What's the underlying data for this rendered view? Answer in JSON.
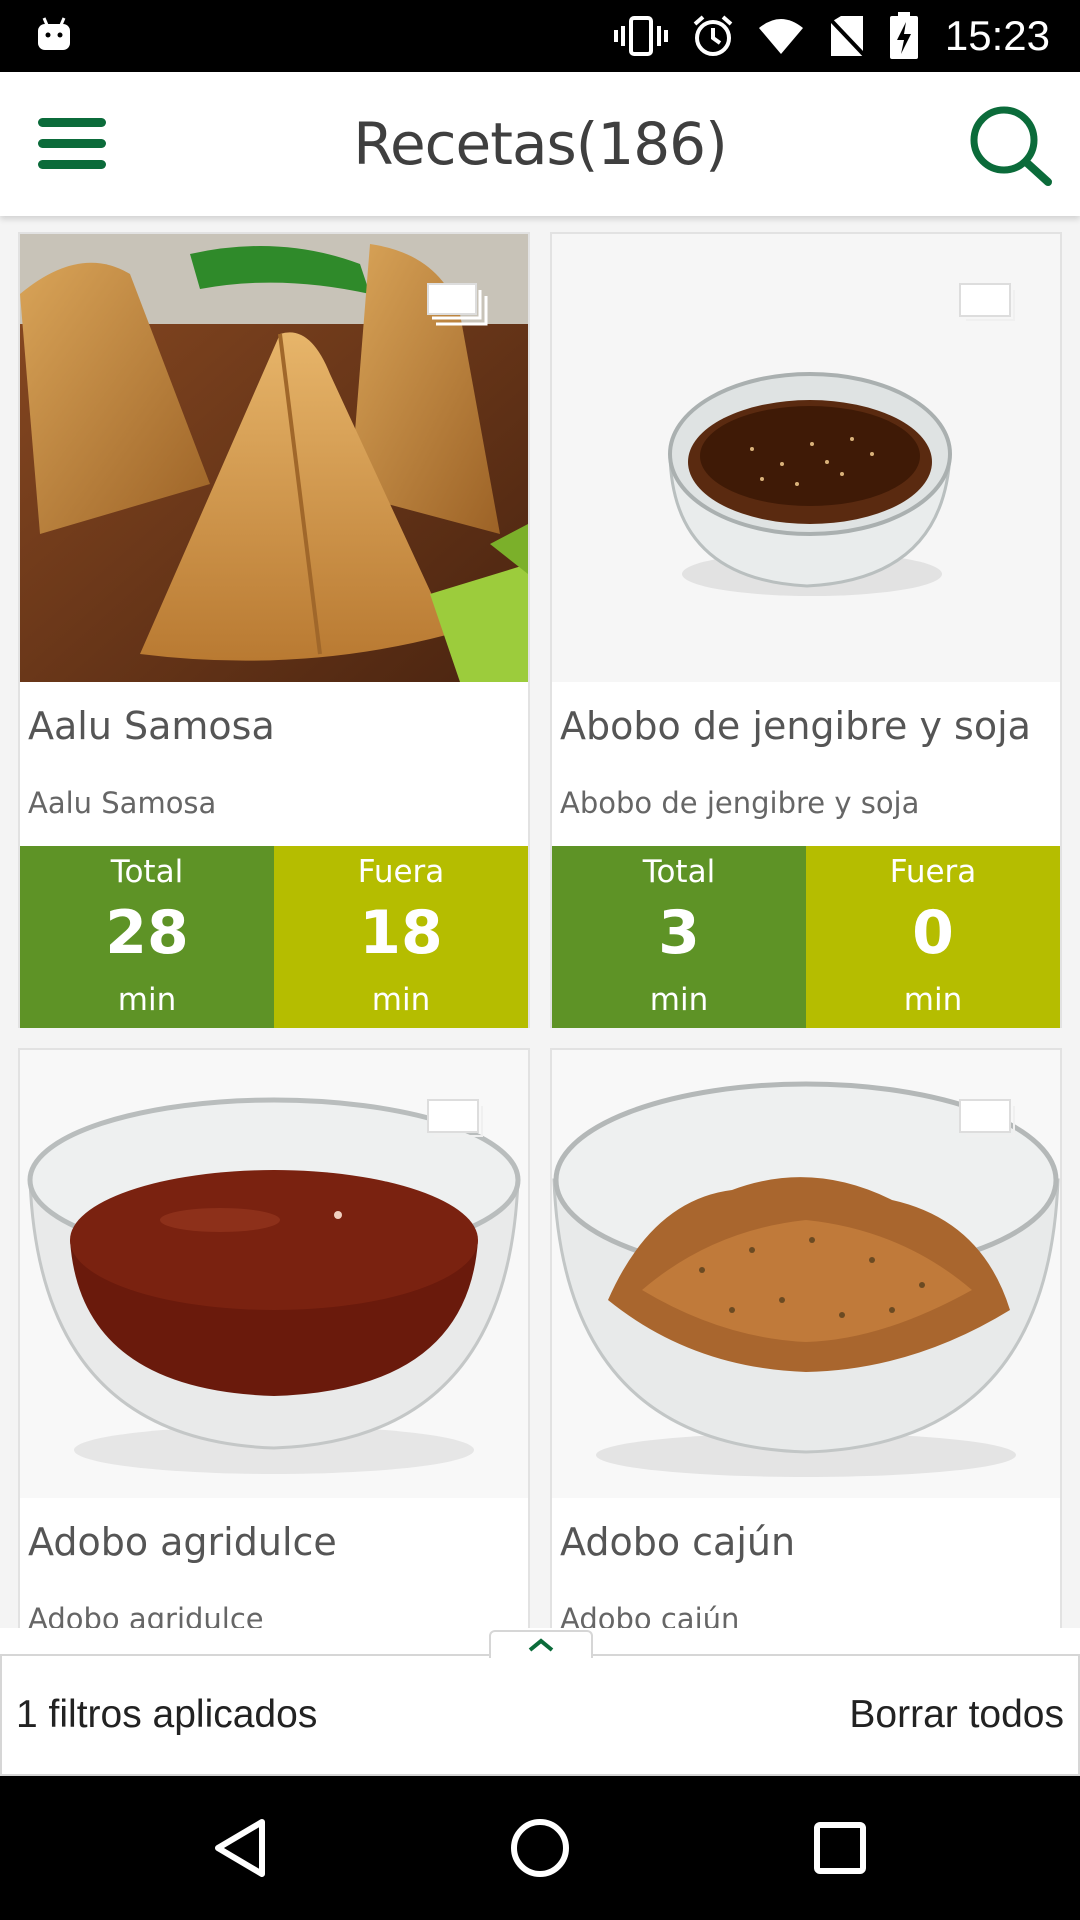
{
  "status_bar": {
    "time": "15:23",
    "icons": [
      "android-icon",
      "vibrate-icon",
      "alarm-icon",
      "wifi-icon",
      "no-sim-icon",
      "battery-charging-icon"
    ]
  },
  "app_bar": {
    "title": "Recetas(186)",
    "menu_icon": "hamburger-menu-icon",
    "search_icon": "search-icon",
    "accent_color": "#0b6b3a"
  },
  "recipes": [
    {
      "title": "Aalu Samosa",
      "subtitle": "Aalu Samosa",
      "total_label": "Total",
      "total_value": "28",
      "total_unit": "min",
      "fuera_label": "Fuera",
      "fuera_value": "18",
      "fuera_unit": "min",
      "multi_image": true
    },
    {
      "title": "Abobo de jengibre y soja",
      "subtitle": "Abobo de jengibre y soja",
      "total_label": "Total",
      "total_value": "3",
      "total_unit": "min",
      "fuera_label": "Fuera",
      "fuera_value": "0",
      "fuera_unit": "min",
      "multi_image": false
    },
    {
      "title": "Adobo agridulce",
      "subtitle": "Adobo agridulce",
      "multi_image": false
    },
    {
      "title": "Adobo cajún",
      "subtitle": "Adobo cajún",
      "multi_image": false
    }
  ],
  "colors": {
    "total_green": "#5e9326",
    "fuera_lime": "#b5bd00"
  },
  "filter_bar": {
    "applied_text": "1 filtros aplicados",
    "clear_label": "Borrar todos",
    "expand_icon": "chevron-up-icon"
  },
  "nav_bar": {
    "icons": [
      "back-icon",
      "home-icon",
      "recents-icon"
    ]
  }
}
